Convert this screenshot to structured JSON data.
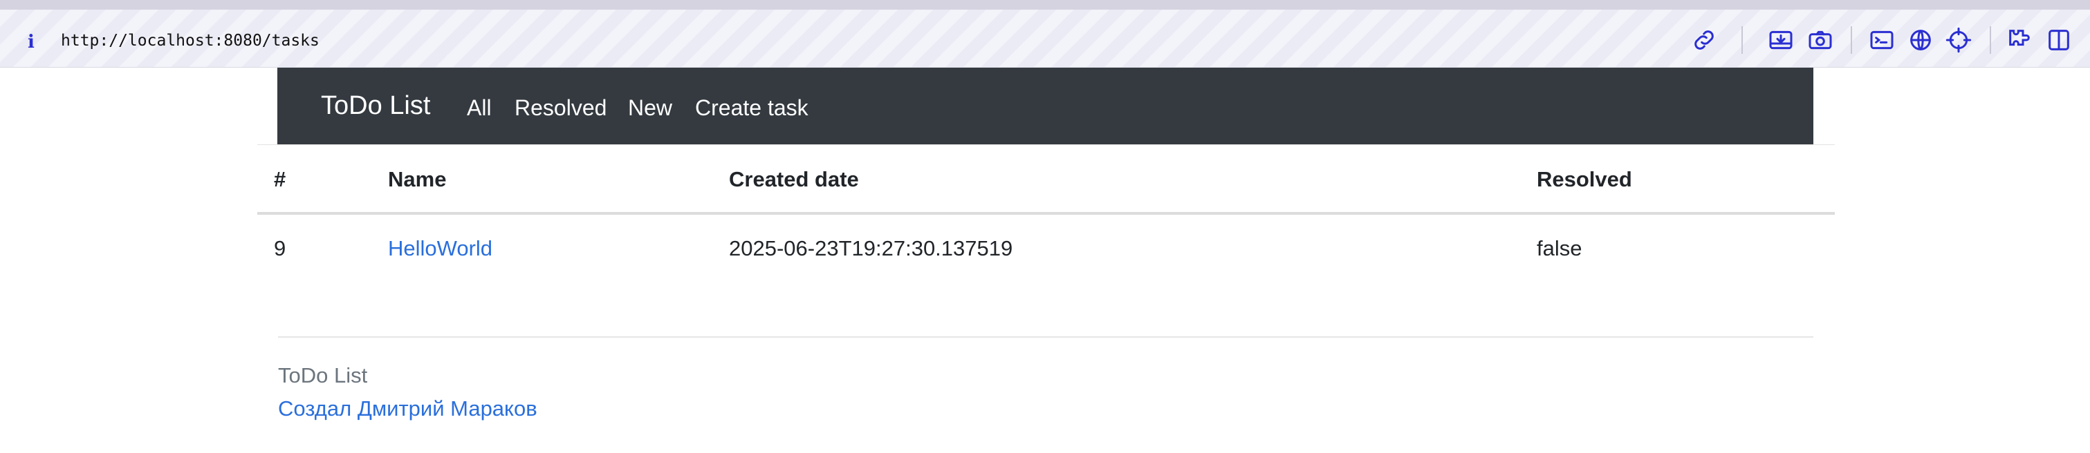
{
  "browser": {
    "info_icon": "i",
    "url": "http://localhost:8080/tasks",
    "toolbar_icons": [
      "link-icon",
      "download-icon",
      "camera-icon",
      "terminal-icon",
      "globe-icon",
      "crosshair-icon",
      "extensions-icon",
      "sidebar-icon"
    ]
  },
  "navbar": {
    "brand": "ToDo List",
    "links": [
      "All",
      "Resolved",
      "New",
      "Create task"
    ],
    "bg_color": "#343a40"
  },
  "table": {
    "headers": [
      "#",
      "Name",
      "Created date",
      "Resolved"
    ],
    "rows": [
      {
        "id": "9",
        "name": "HelloWorld",
        "created": "2025-06-23T19:27:30.137519",
        "resolved": "false"
      }
    ]
  },
  "footer": {
    "title": "ToDo List",
    "author": "Создал Дмитрий Мараков"
  },
  "colors": {
    "link": "#2a6fdb",
    "accent": "#2a2fd1"
  }
}
